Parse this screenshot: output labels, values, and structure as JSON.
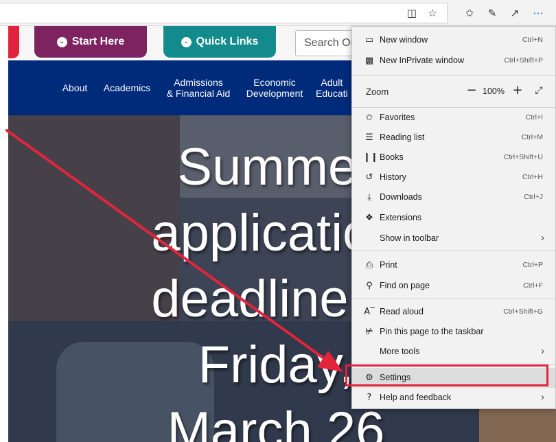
{
  "browser": {
    "toolbar_icons": [
      "reading-view-icon",
      "favorite-star-icon",
      "favorites-hub-icon",
      "make-note-icon",
      "share-icon",
      "settings-more-icon"
    ]
  },
  "site": {
    "start_here": "Start Here",
    "quick_links": "Quick Links",
    "search_placeholder": "Search Ou",
    "nav": [
      {
        "line1": "About",
        "line2": ""
      },
      {
        "line1": "Academics",
        "line2": ""
      },
      {
        "line1": "Admissions",
        "line2": "& Financial Aid"
      },
      {
        "line1": "Economic",
        "line2": "Development"
      },
      {
        "line1": "Adult",
        "line2": "Educati"
      }
    ],
    "hero_lines": [
      "Summer",
      "application",
      "deadline is",
      "Friday,",
      "March 26"
    ]
  },
  "menu": {
    "new_window": {
      "label": "New window",
      "shortcut": "Ctrl+N"
    },
    "new_inprivate": {
      "label": "New InPrivate window",
      "shortcut": "Ctrl+Shift+P"
    },
    "zoom": {
      "label": "Zoom",
      "value": "100%"
    },
    "favorites": {
      "label": "Favorites",
      "shortcut": "Ctrl+I"
    },
    "reading_list": {
      "label": "Reading list",
      "shortcut": "Ctrl+M"
    },
    "books": {
      "label": "Books",
      "shortcut": "Ctrl+Shift+U"
    },
    "history": {
      "label": "History",
      "shortcut": "Ctrl+H"
    },
    "downloads": {
      "label": "Downloads",
      "shortcut": "Ctrl+J"
    },
    "extensions": {
      "label": "Extensions"
    },
    "show_in_toolbar": {
      "label": "Show in toolbar"
    },
    "print": {
      "label": "Print",
      "shortcut": "Ctrl+P"
    },
    "find_on_page": {
      "label": "Find on page",
      "shortcut": "Ctrl+F"
    },
    "read_aloud": {
      "label": "Read aloud",
      "shortcut": "Ctrl+Shift+G"
    },
    "pin_taskbar": {
      "label": "Pin this page to the taskbar"
    },
    "more_tools": {
      "label": "More tools"
    },
    "settings": {
      "label": "Settings"
    },
    "help": {
      "label": "Help and feedback"
    }
  },
  "annotation": {
    "color": "#e3243b",
    "highlighted_item": "Settings"
  }
}
